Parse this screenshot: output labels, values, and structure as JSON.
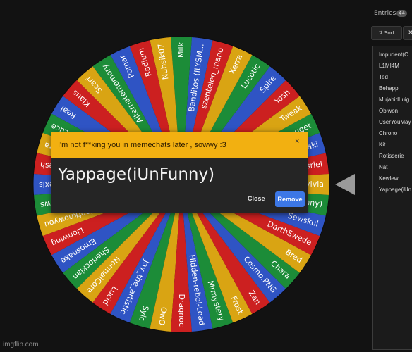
{
  "wheel": {
    "colors": [
      "#cc2020",
      "#2f54c4",
      "#1c8c38",
      "#d9a413"
    ],
    "pointer_icon": "triangle-pointer-icon",
    "segment_labels": [
      "Asriel",
      "Saki",
      "Nugget",
      "Tweak",
      "Yosh",
      "Spire",
      "Lucotic",
      "Xerra",
      "szentelen_mano",
      "Banditos (ILYSM...",
      "Milk",
      "Nubsik07",
      "Radium",
      "Pomar",
      "Alternatememory",
      "Scarf",
      "Klaus",
      "Real",
      "Luce",
      "Aurora",
      "Yapdesh",
      "Alexis",
      "Thaws",
      "Idontknowyou",
      "Lionwing",
      "Emosnake",
      "Sherlockian",
      "NormalCore",
      "Lucid",
      "Jay_the_artistic",
      "Sylc",
      "OwO",
      "Dragnoc",
      "Hidden-rebel-Lead",
      "Mrmystery",
      "Frost",
      "Zan",
      "Cosmo.PNG",
      "Chara",
      "Bred",
      "DarthSwede",
      "Sewskul",
      "Funny)",
      "Sylvia"
    ]
  },
  "dialog": {
    "title": "I'm not f**king you in memechats later , sowwy :3",
    "winner": "Yappage(iUnFunny)",
    "close_x": "×",
    "close_label": "Close",
    "remove_label": "Remove",
    "header_color": "#f2b011",
    "remove_color": "#3c77e6"
  },
  "sidebar": {
    "title": "Entries",
    "count": "44",
    "sort_label": "Sort",
    "shuffle_icon": "shuffle-icon",
    "entries": [
      "Impudent(C",
      "L1MI4M",
      "Ted",
      "Behapp",
      "MujahidLuig",
      "Obiwon",
      "UserYouMay",
      "Chrono",
      "Kit",
      "Rotisserie",
      "Nat",
      "Kewlew",
      "Yappage(iUn"
    ]
  },
  "watermark": "imgflip.com"
}
